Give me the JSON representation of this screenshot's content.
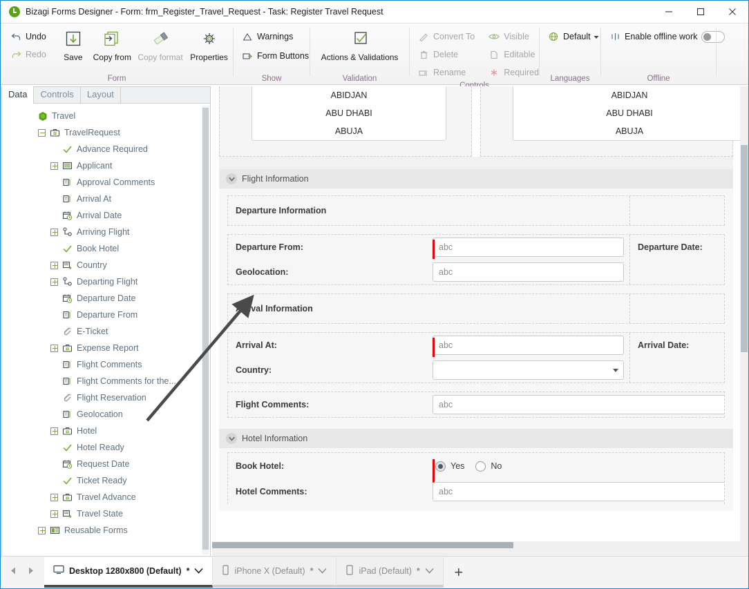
{
  "window": {
    "title": "Bizagi Forms Designer  - Form: frm_Register_Travel_Request - Task:  Register Travel Request",
    "app_icon": "bizagi-logo-icon",
    "minimize": "minimize-icon",
    "maximize": "maximize-icon",
    "close": "close-icon"
  },
  "ribbon": {
    "groups": [
      {
        "label": "Form"
      },
      {
        "label": "Show"
      },
      {
        "label": "Validation"
      },
      {
        "label": "Controls"
      },
      {
        "label": "Languages"
      },
      {
        "label": "Offline"
      }
    ],
    "undo": "Undo",
    "redo": "Redo",
    "save": "Save",
    "copy_from": "Copy from",
    "copy_format": "Copy format",
    "properties": "Properties",
    "warnings": "Warnings",
    "form_buttons": "Form Buttons",
    "actions_validations": "Actions & Validations",
    "convert_to": "Convert To",
    "delete": "Delete",
    "rename": "Rename",
    "visible": "Visible",
    "editable": "Editable",
    "required": "Required",
    "language_default": "Default",
    "enable_offline": "Enable offline work",
    "offline_toggle_state": "off"
  },
  "left_panel": {
    "tabs": [
      {
        "label": "Data",
        "active": true
      },
      {
        "label": "Controls",
        "active": false
      },
      {
        "label": "Layout",
        "active": false
      }
    ],
    "tree": [
      {
        "label": "Travel",
        "indent": 0,
        "expander": "none",
        "icon": "hexagon-entity-icon"
      },
      {
        "label": "TravelRequest",
        "indent": 1,
        "expander": "minus",
        "icon": "briefcase-icon"
      },
      {
        "label": "Advance Required",
        "indent": 2,
        "expander": "none",
        "icon": "check-boolean-icon"
      },
      {
        "label": "Applicant",
        "indent": 2,
        "expander": "plus",
        "icon": "table-entity-icon"
      },
      {
        "label": "Approval Comments",
        "indent": 2,
        "expander": "none",
        "icon": "text-field-icon"
      },
      {
        "label": "Arrival At",
        "indent": 2,
        "expander": "none",
        "icon": "text-field-icon"
      },
      {
        "label": "Arrival Date",
        "indent": 2,
        "expander": "none",
        "icon": "calendar-clock-icon"
      },
      {
        "label": "Arriving Flight",
        "indent": 2,
        "expander": "plus",
        "icon": "relation-icon"
      },
      {
        "label": "Book Hotel",
        "indent": 2,
        "expander": "none",
        "icon": "check-boolean-icon"
      },
      {
        "label": "Country",
        "indent": 2,
        "expander": "plus",
        "icon": "parameter-entity-icon"
      },
      {
        "label": "Departing Flight",
        "indent": 2,
        "expander": "plus",
        "icon": "relation-icon"
      },
      {
        "label": "Departure Date",
        "indent": 2,
        "expander": "none",
        "icon": "calendar-clock-icon"
      },
      {
        "label": "Departure From",
        "indent": 2,
        "expander": "none",
        "icon": "text-field-icon"
      },
      {
        "label": "E-Ticket",
        "indent": 2,
        "expander": "none",
        "icon": "paperclip-icon"
      },
      {
        "label": "Expense Report",
        "indent": 2,
        "expander": "plus",
        "icon": "briefcase-icon"
      },
      {
        "label": "Flight Comments",
        "indent": 2,
        "expander": "none",
        "icon": "text-field-icon"
      },
      {
        "label": "Flight Comments for the...",
        "indent": 2,
        "expander": "none",
        "icon": "text-field-icon"
      },
      {
        "label": "Flight Reservation",
        "indent": 2,
        "expander": "none",
        "icon": "paperclip-icon"
      },
      {
        "label": "Geolocation",
        "indent": 2,
        "expander": "none",
        "icon": "text-field-icon"
      },
      {
        "label": "Hotel",
        "indent": 2,
        "expander": "plus",
        "icon": "briefcase-icon"
      },
      {
        "label": "Hotel Ready",
        "indent": 2,
        "expander": "none",
        "icon": "check-boolean-icon"
      },
      {
        "label": "Request Date",
        "indent": 2,
        "expander": "none",
        "icon": "calendar-clock-icon"
      },
      {
        "label": "Ticket Ready",
        "indent": 2,
        "expander": "none",
        "icon": "check-boolean-icon"
      },
      {
        "label": "Travel Advance",
        "indent": 2,
        "expander": "plus",
        "icon": "briefcase-icon"
      },
      {
        "label": "Travel State",
        "indent": 2,
        "expander": "plus",
        "icon": "parameter-entity-icon"
      },
      {
        "label": "Reusable Forms",
        "indent": 1,
        "expander": "plus",
        "icon": "forms-icon"
      }
    ]
  },
  "form": {
    "top_lists": {
      "left_items": [
        "ABIDJAN",
        "ABU DHABI",
        "ABUJA"
      ],
      "right_items": [
        "ABIDJAN",
        "ABU DHABI",
        "ABUJA"
      ]
    },
    "sections": [
      {
        "title": "Flight Information",
        "blocks": [
          {
            "header": "Departure Information"
          },
          {
            "rows": [
              {
                "label": "Departure From:",
                "control": "text",
                "value": "abc",
                "required": true,
                "side_label": "Departure Date:"
              },
              {
                "label": "Geolocation:",
                "control": "text",
                "value": "abc",
                "required": false,
                "side_label": ""
              }
            ]
          },
          {
            "header": "Arrival Information"
          },
          {
            "rows": [
              {
                "label": "Arrival At:",
                "control": "text",
                "value": "abc",
                "required": true,
                "side_label": "Arrival Date:"
              },
              {
                "label": "Country:",
                "control": "select",
                "value": "",
                "required": false,
                "side_label": ""
              }
            ]
          },
          {
            "rows": [
              {
                "label": "Flight Comments:",
                "control": "text",
                "value": "abc",
                "required": false,
                "side_label": ""
              }
            ]
          }
        ]
      },
      {
        "title": "Hotel Information",
        "blocks": [
          {
            "rows": [
              {
                "label": "Book Hotel:",
                "control": "radio",
                "options": [
                  "Yes",
                  "No"
                ],
                "selected": "Yes",
                "required": true
              },
              {
                "label": "Hotel Comments:",
                "control": "text",
                "value": "abc",
                "required": false
              }
            ]
          }
        ]
      }
    ]
  },
  "device_bar": {
    "prev": "prev-arrow",
    "next": "next-arrow",
    "tabs": [
      {
        "label": "Desktop 1280x800 (Default)",
        "star": "*",
        "icon": "monitor-icon",
        "active": true
      },
      {
        "label": "iPhone X (Default)",
        "star": "*",
        "icon": "phone-icon",
        "active": false
      },
      {
        "label": "iPad (Default)",
        "star": "*",
        "icon": "tablet-icon",
        "active": false
      }
    ],
    "add": "+"
  },
  "colors": {
    "accent_green": "#7aa63c",
    "required_red": "#e8000a",
    "window_border": "#1b87c9",
    "group_label": "#8b6f8b"
  }
}
